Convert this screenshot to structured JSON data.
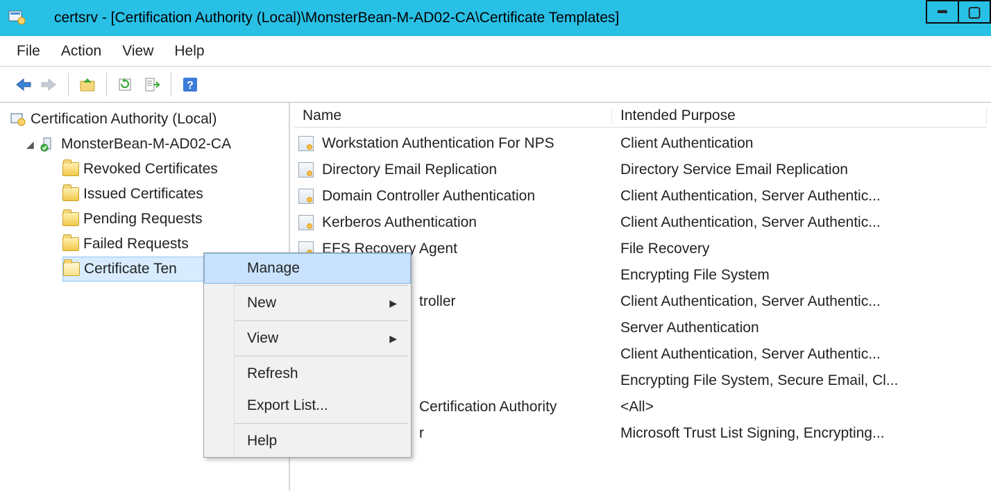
{
  "window": {
    "title": "certsrv - [Certification Authority (Local)\\MonsterBean-M-AD02-CA\\Certificate Templates]"
  },
  "menubar": {
    "items": [
      "File",
      "Action",
      "View",
      "Help"
    ]
  },
  "tree": {
    "root": "Certification Authority (Local)",
    "ca_node": "MonsterBean-M-AD02-CA",
    "children": [
      "Revoked Certificates",
      "Issued Certificates",
      "Pending Requests",
      "Failed Requests",
      "Certificate Templates"
    ],
    "selected_display": "Certificate Ten"
  },
  "columns": {
    "name": "Name",
    "purpose": "Intended Purpose"
  },
  "templates": [
    {
      "name": "Workstation Authentication For NPS",
      "purpose": "Client Authentication"
    },
    {
      "name": "Directory Email Replication",
      "purpose": "Directory Service Email Replication"
    },
    {
      "name": "Domain Controller Authentication",
      "purpose": "Client Authentication, Server Authentic..."
    },
    {
      "name": "Kerberos Authentication",
      "purpose": "Client Authentication, Server Authentic..."
    },
    {
      "name": "EFS Recovery Agent",
      "purpose": "File Recovery"
    },
    {
      "name": "",
      "purpose": "Encrypting File System"
    },
    {
      "name": "troller",
      "purpose": "Client Authentication, Server Authentic..."
    },
    {
      "name": "",
      "purpose": "Server Authentication"
    },
    {
      "name": "",
      "purpose": "Client Authentication, Server Authentic..."
    },
    {
      "name": "",
      "purpose": "Encrypting File System, Secure Email, Cl..."
    },
    {
      "name": " Certification Authority",
      "purpose": "<All>"
    },
    {
      "name": "r",
      "purpose": "Microsoft Trust List Signing, Encrypting..."
    }
  ],
  "context_menu": {
    "items": [
      {
        "label": "Manage",
        "highlight": true,
        "submenu": false
      },
      {
        "sep": true
      },
      {
        "label": "New",
        "submenu": true
      },
      {
        "sep": true
      },
      {
        "label": "View",
        "submenu": true
      },
      {
        "sep": true
      },
      {
        "label": "Refresh",
        "submenu": false
      },
      {
        "label": "Export List...",
        "submenu": false
      },
      {
        "sep": true
      },
      {
        "label": "Help",
        "submenu": false
      }
    ]
  }
}
